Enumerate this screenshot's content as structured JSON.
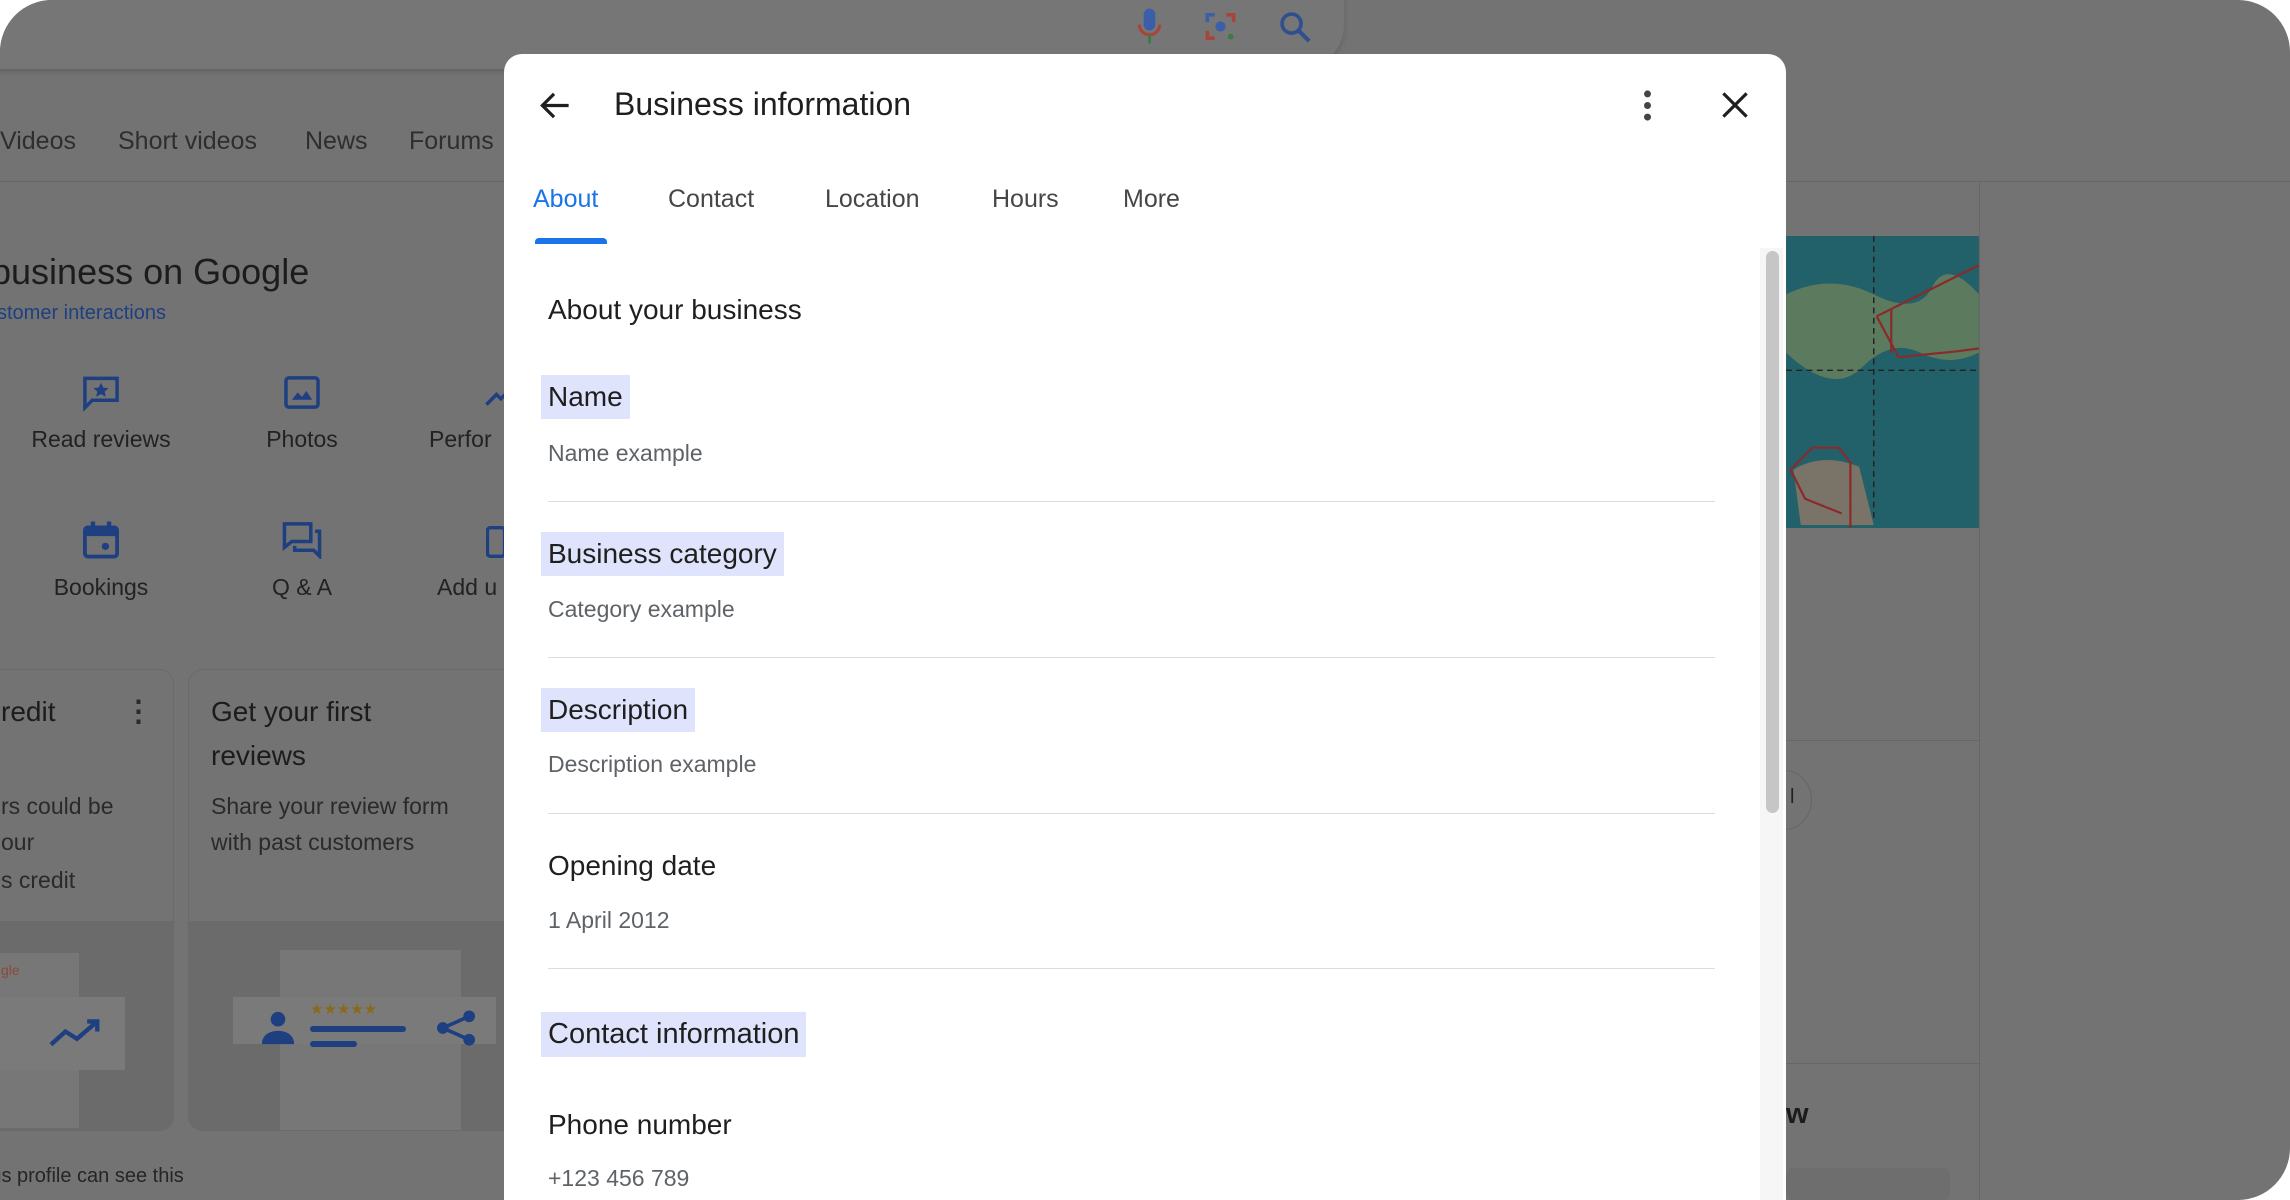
{
  "background": {
    "search_icons": [
      "mic-icon",
      "lens-icon",
      "search-icon"
    ],
    "nav_tabs": [
      "Videos",
      "Short videos",
      "News",
      "Forums"
    ],
    "heading": "business on Google",
    "subheading": "stomer interactions",
    "actions": [
      {
        "label": "Read reviews",
        "icon": "review-star-icon"
      },
      {
        "label": "Photos",
        "icon": "photo-icon"
      },
      {
        "label": "Perfor",
        "icon": "performance-icon"
      },
      {
        "label": "Bookings",
        "icon": "calendar-icon"
      },
      {
        "label": "Q & A",
        "icon": "qa-icon"
      },
      {
        "label": "Add u",
        "icon": "update-icon"
      }
    ],
    "card_credit": {
      "title": "redit",
      "lines": [
        "rs could be",
        "our",
        "s credit"
      ],
      "logo_text": "gle"
    },
    "card_reviews": {
      "title_lines": [
        "Get your first",
        "reviews"
      ],
      "lines": [
        "Share your review form",
        "with past customers"
      ],
      "stars": "★★★★★"
    },
    "footer_note": "is profile can see this",
    "right_partial": "w",
    "right_button_partial": "l"
  },
  "modal": {
    "title": "Business information",
    "tabs": [
      "About",
      "Contact",
      "Location",
      "Hours",
      "More"
    ],
    "active_tab": "About",
    "section_title": "About your business",
    "fields": [
      {
        "label": "Name",
        "value": "Name example"
      },
      {
        "label": "Business category",
        "value": "Category example"
      },
      {
        "label": "Description",
        "value": "Description example"
      },
      {
        "label": "Opening date",
        "value": "1 April 2012"
      }
    ],
    "contact_section_title": "Contact information",
    "contact_fields": [
      {
        "label": "Phone number",
        "value": "+123 456 789"
      }
    ]
  },
  "colors": {
    "accent": "#1a73e8",
    "highlight": "#dfe3fb",
    "overlay": "#737373"
  }
}
